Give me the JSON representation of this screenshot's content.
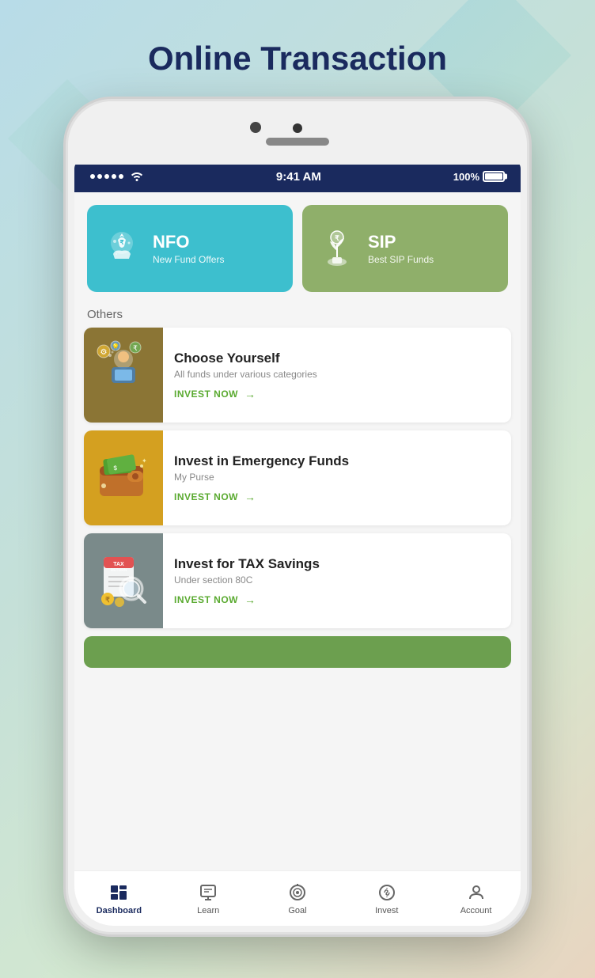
{
  "page": {
    "title": "Online Transaction",
    "background": "#b8dce8"
  },
  "status_bar": {
    "time": "9:41 AM",
    "battery": "100%",
    "signal_dots": 5
  },
  "top_cards": [
    {
      "id": "nfo",
      "title": "NFO",
      "subtitle": "New Fund Offers",
      "bg_color": "#3dbfce"
    },
    {
      "id": "sip",
      "title": "SIP",
      "subtitle": "Best SIP Funds",
      "bg_color": "#8faf6a"
    }
  ],
  "others_label": "Others",
  "list_items": [
    {
      "id": "choose-yourself",
      "title": "Choose Yourself",
      "subtitle": "All funds under various categories",
      "cta": "INVEST NOW",
      "img_bg": "#8b7535"
    },
    {
      "id": "emergency-funds",
      "title": "Invest in Emergency Funds",
      "subtitle": "My Purse",
      "cta": "INVEST NOW",
      "img_bg": "#d4a020"
    },
    {
      "id": "tax-savings",
      "title": "Invest for TAX Savings",
      "subtitle": "Under section 80C",
      "cta": "INVEST NOW",
      "img_bg": "#7a8a8a"
    }
  ],
  "bottom_nav": [
    {
      "id": "dashboard",
      "label": "Dashboard",
      "active": true
    },
    {
      "id": "learn",
      "label": "Learn",
      "active": false
    },
    {
      "id": "goal",
      "label": "Goal",
      "active": false
    },
    {
      "id": "invest",
      "label": "Invest",
      "active": false
    },
    {
      "id": "account",
      "label": "Account",
      "active": false
    }
  ]
}
